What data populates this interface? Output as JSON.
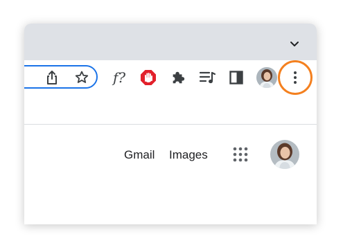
{
  "window": {
    "tabstrip": {
      "tab_search_icon": "chevron-down-icon"
    }
  },
  "toolbar": {
    "omnibox_icons": [
      "share-icon",
      "bookmark-star-icon"
    ],
    "extension_formula_label": "f?",
    "extensions": [
      "formula-extension-icon",
      "adblock-hand-icon",
      "extensions-puzzle-icon",
      "reading-list-icon",
      "side-panel-icon"
    ],
    "profile_icon": "avatar",
    "menu_icon": "more-vert-icon",
    "highlight_color": "#f4801f",
    "accent_color": "#1a73e8"
  },
  "google_bar": {
    "gmail_label": "Gmail",
    "images_label": "Images",
    "apps_icon": "apps-grid-icon",
    "account_icon": "avatar"
  }
}
